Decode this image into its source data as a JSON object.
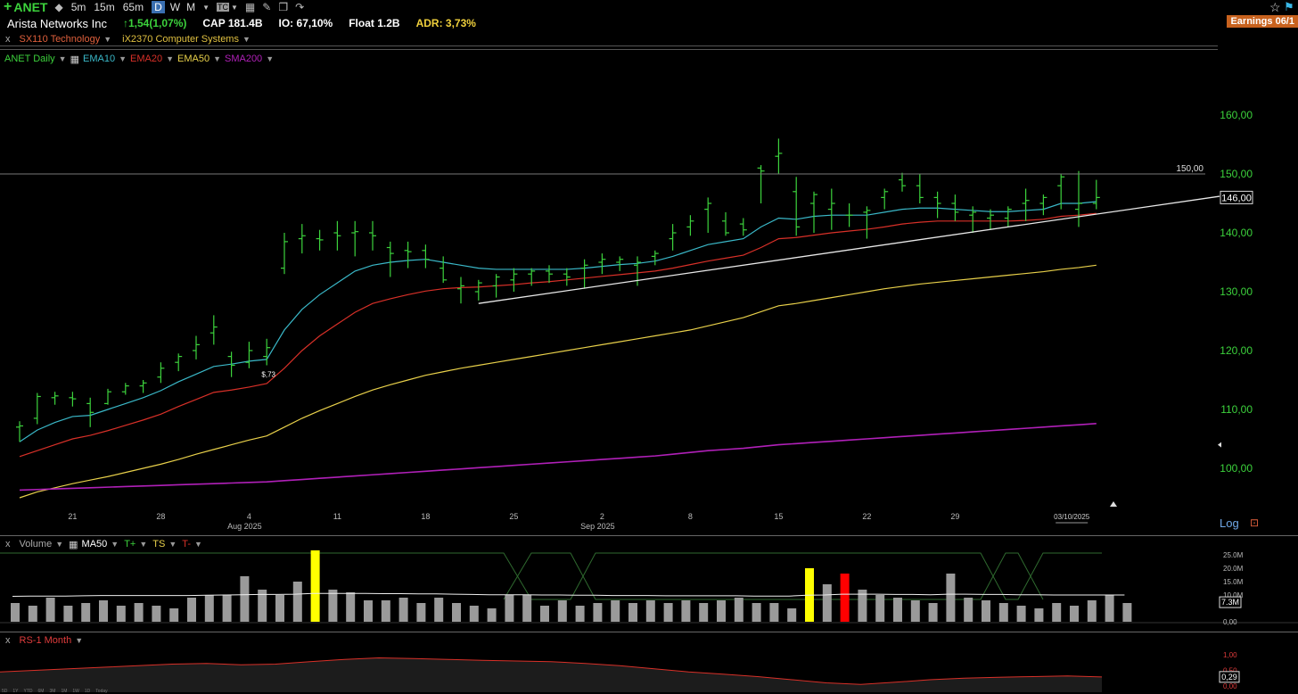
{
  "toolbar": {
    "ticker": "ANET",
    "timeframes": [
      "5m",
      "15m",
      "65m",
      "D",
      "W",
      "M"
    ],
    "active_timeframe": "D",
    "icons": [
      "plus-icon",
      "chart-type-icon",
      "tc-icon",
      "grid-icon",
      "pencil-icon",
      "copy-icon",
      "redo-icon",
      "star-icon",
      "flag-icon"
    ]
  },
  "info": {
    "company": "Arista Networks Inc",
    "change": "↑1,54(1,07%)",
    "cap": "CAP 181.4B",
    "io": "IO: 67,10%",
    "float": "Float 1.2B",
    "adr": "ADR: 3,73%",
    "earnings": "Earnings 06/1"
  },
  "sector": {
    "close": "x",
    "sector": "SX110 Technology",
    "industry": "iX2370 Computer Systems"
  },
  "legend": {
    "symbol": "ANET Daily",
    "ema10": "EMA10",
    "ema20": "EMA20",
    "ema50": "EMA50",
    "sma200": "SMA200",
    "colors": {
      "symbol": "#3cd23c",
      "ema10": "#3ab8c8",
      "ema20": "#d83028",
      "ema50": "#e8d04a",
      "sma200": "#b020b8"
    }
  },
  "chart_data": {
    "type": "ohlc",
    "title": "ANET Daily",
    "ylim": [
      95,
      165
    ],
    "y_ticks": [
      "160,00",
      "150,00",
      "140,00",
      "130,00",
      "120,00",
      "110,00",
      "100,00"
    ],
    "x_ticks": [
      "21",
      "28",
      "4",
      "11",
      "18",
      "25",
      "2",
      "8",
      "15",
      "22",
      "29",
      "03/10/2025"
    ],
    "x_month_labels": [
      "Aug 2025",
      "Sep 2025"
    ],
    "last_price_label": "146,00",
    "level_line_label": "150,00",
    "annotation": "$,73",
    "bars": [
      {
        "o": 107.0,
        "h": 108.0,
        "l": 104.5,
        "c": 107.2
      },
      {
        "o": 108.5,
        "h": 112.8,
        "l": 107.5,
        "c": 112.2
      },
      {
        "o": 112.0,
        "h": 113.0,
        "l": 110.8,
        "c": 112.3
      },
      {
        "o": 112.0,
        "h": 113.0,
        "l": 110.5,
        "c": 111.8
      },
      {
        "o": 111.0,
        "h": 112.0,
        "l": 107.0,
        "c": 109.5
      },
      {
        "o": 111.0,
        "h": 113.5,
        "l": 110.8,
        "c": 113.0
      },
      {
        "o": 113.0,
        "h": 114.5,
        "l": 112.5,
        "c": 114.0
      },
      {
        "o": 114.0,
        "h": 115.0,
        "l": 112.8,
        "c": 114.5
      },
      {
        "o": 115.5,
        "h": 118.0,
        "l": 114.5,
        "c": 117.0
      },
      {
        "o": 118.0,
        "h": 119.5,
        "l": 116.5,
        "c": 119.0
      },
      {
        "o": 120.0,
        "h": 122.5,
        "l": 118.5,
        "c": 121.0
      },
      {
        "o": 123.0,
        "h": 126.0,
        "l": 121.0,
        "c": 124.0
      },
      {
        "o": 119.0,
        "h": 119.8,
        "l": 115.5,
        "c": 117.5
      },
      {
        "o": 118.0,
        "h": 121.5,
        "l": 117.0,
        "c": 120.0
      },
      {
        "o": 119.0,
        "h": 122.0,
        "l": 117.5,
        "c": 120.5
      },
      {
        "o": 134.0,
        "h": 140.0,
        "l": 133.0,
        "c": 138.5
      },
      {
        "o": 139.0,
        "h": 141.5,
        "l": 136.5,
        "c": 139.5
      },
      {
        "o": 139.0,
        "h": 140.5,
        "l": 137.0,
        "c": 138.8
      },
      {
        "o": 140.0,
        "h": 142.0,
        "l": 137.0,
        "c": 139.5
      },
      {
        "o": 140.0,
        "h": 142.0,
        "l": 136.0,
        "c": 140.2
      },
      {
        "o": 140.0,
        "h": 142.0,
        "l": 137.0,
        "c": 139.5
      },
      {
        "o": 137.5,
        "h": 138.5,
        "l": 132.5,
        "c": 136.5
      },
      {
        "o": 137.0,
        "h": 138.5,
        "l": 134.0,
        "c": 136.8
      },
      {
        "o": 137.0,
        "h": 138.0,
        "l": 134.0,
        "c": 135.5
      },
      {
        "o": 134.0,
        "h": 136.0,
        "l": 131.5,
        "c": 132.0
      },
      {
        "o": 130.5,
        "h": 132.5,
        "l": 128.0,
        "c": 131.0
      },
      {
        "o": 130.0,
        "h": 132.0,
        "l": 128.5,
        "c": 131.5
      },
      {
        "o": 131.0,
        "h": 133.0,
        "l": 129.0,
        "c": 132.5
      },
      {
        "o": 132.0,
        "h": 134.0,
        "l": 130.0,
        "c": 133.0
      },
      {
        "o": 133.0,
        "h": 134.0,
        "l": 131.0,
        "c": 133.5
      },
      {
        "o": 133.5,
        "h": 134.5,
        "l": 131.5,
        "c": 133.0
      },
      {
        "o": 133.0,
        "h": 134.0,
        "l": 131.0,
        "c": 132.5
      },
      {
        "o": 134.0,
        "h": 135.5,
        "l": 130.5,
        "c": 134.5
      },
      {
        "o": 135.0,
        "h": 136.5,
        "l": 133.0,
        "c": 135.5
      },
      {
        "o": 135.0,
        "h": 136.0,
        "l": 133.5,
        "c": 135.5
      },
      {
        "o": 134.5,
        "h": 136.0,
        "l": 131.0,
        "c": 135.0
      },
      {
        "o": 136.0,
        "h": 137.0,
        "l": 134.5,
        "c": 136.5
      },
      {
        "o": 139.0,
        "h": 141.5,
        "l": 137.0,
        "c": 140.0
      },
      {
        "o": 141.0,
        "h": 143.0,
        "l": 139.5,
        "c": 142.0
      },
      {
        "o": 144.0,
        "h": 146.0,
        "l": 140.0,
        "c": 145.0
      },
      {
        "o": 142.0,
        "h": 143.5,
        "l": 139.5,
        "c": 140.0
      },
      {
        "o": 141.5,
        "h": 142.5,
        "l": 139.5,
        "c": 140.5
      },
      {
        "o": 151.0,
        "h": 151.5,
        "l": 145.0,
        "c": 150.5
      },
      {
        "o": 153.0,
        "h": 156.0,
        "l": 150.0,
        "c": 153.5
      },
      {
        "o": 147.0,
        "h": 149.5,
        "l": 139.5,
        "c": 141.0
      },
      {
        "o": 145.0,
        "h": 147.0,
        "l": 140.0,
        "c": 146.5
      },
      {
        "o": 144.0,
        "h": 147.5,
        "l": 140.5,
        "c": 145.0
      },
      {
        "o": 143.0,
        "h": 145.0,
        "l": 141.0,
        "c": 143.0
      },
      {
        "o": 143.5,
        "h": 144.5,
        "l": 139.0,
        "c": 143.8
      },
      {
        "o": 146.0,
        "h": 147.5,
        "l": 144.0,
        "c": 147.0
      },
      {
        "o": 149.0,
        "h": 150.2,
        "l": 147.0,
        "c": 148.0
      },
      {
        "o": 148.0,
        "h": 150.0,
        "l": 145.0,
        "c": 146.0
      },
      {
        "o": 146.0,
        "h": 147.0,
        "l": 142.5,
        "c": 145.0
      },
      {
        "o": 145.0,
        "h": 146.5,
        "l": 142.0,
        "c": 143.5
      },
      {
        "o": 143.0,
        "h": 144.5,
        "l": 140.0,
        "c": 143.5
      },
      {
        "o": 142.5,
        "h": 144.0,
        "l": 140.5,
        "c": 143.0
      },
      {
        "o": 142.5,
        "h": 144.5,
        "l": 141.0,
        "c": 144.0
      },
      {
        "o": 145.0,
        "h": 147.5,
        "l": 142.0,
        "c": 145.5
      },
      {
        "o": 145.0,
        "h": 146.5,
        "l": 143.0,
        "c": 146.0
      },
      {
        "o": 148.0,
        "h": 150.0,
        "l": 144.0,
        "c": 149.5
      },
      {
        "o": 144.0,
        "h": 150.5,
        "l": 141.0,
        "c": 145.0
      },
      {
        "o": 145.0,
        "h": 149.0,
        "l": 144.0,
        "c": 146.0
      }
    ],
    "series": [
      {
        "name": "EMA10",
        "color": "#3ab8c8",
        "values": [
          104.5,
          106.5,
          107.8,
          108.8,
          109.0,
          110.0,
          111.0,
          112.0,
          113.2,
          114.7,
          116.0,
          117.3,
          117.7,
          118.2,
          118.5,
          123.5,
          127.0,
          129.5,
          131.5,
          133.5,
          134.5,
          135.0,
          135.3,
          135.5,
          135.0,
          134.5,
          134.0,
          133.8,
          133.8,
          133.8,
          133.8,
          133.8,
          134.0,
          134.3,
          134.6,
          134.8,
          135.2,
          136.0,
          137.0,
          138.0,
          138.5,
          139.0,
          141.0,
          142.5,
          142.3,
          142.8,
          143.0,
          143.0,
          143.0,
          143.5,
          144.0,
          144.2,
          144.2,
          144.0,
          143.8,
          143.6,
          143.6,
          143.8,
          144.0,
          145.0,
          145.0,
          145.3
        ]
      },
      {
        "name": "EMA20",
        "color": "#d83028",
        "values": [
          102.0,
          103.0,
          104.0,
          105.0,
          105.6,
          106.4,
          107.3,
          108.2,
          109.2,
          110.5,
          111.7,
          112.9,
          113.3,
          113.8,
          114.4,
          117.0,
          120.0,
          122.5,
          124.5,
          126.5,
          128.0,
          128.8,
          129.5,
          130.1,
          130.5,
          130.7,
          130.8,
          131.0,
          131.2,
          131.5,
          131.7,
          132.0,
          132.3,
          132.6,
          132.9,
          133.2,
          133.5,
          134.0,
          134.6,
          135.2,
          135.7,
          136.2,
          137.5,
          139.0,
          139.2,
          139.6,
          140.0,
          140.3,
          140.6,
          141.0,
          141.5,
          141.8,
          142.0,
          142.0,
          142.0,
          142.0,
          142.0,
          142.1,
          142.3,
          142.8,
          143.0,
          143.3
        ]
      },
      {
        "name": "EMA50",
        "color": "#e8d04a",
        "values": [
          95.0,
          96.0,
          96.7,
          97.4,
          98.0,
          98.6,
          99.3,
          100.0,
          100.7,
          101.5,
          102.4,
          103.2,
          104.0,
          104.8,
          105.5,
          107.0,
          108.5,
          109.8,
          111.0,
          112.2,
          113.3,
          114.2,
          115.0,
          115.8,
          116.4,
          117.0,
          117.5,
          118.0,
          118.5,
          119.0,
          119.5,
          120.0,
          120.5,
          121.0,
          121.5,
          122.0,
          122.5,
          123.0,
          123.5,
          124.2,
          124.9,
          125.6,
          126.6,
          127.6,
          128.0,
          128.5,
          129.0,
          129.5,
          130.0,
          130.5,
          130.9,
          131.3,
          131.6,
          131.9,
          132.2,
          132.5,
          132.8,
          133.1,
          133.4,
          133.8,
          134.1,
          134.5
        ]
      },
      {
        "name": "SMA200",
        "color": "#b020b8",
        "values": [
          96.3,
          96.4,
          96.5,
          96.6,
          96.7,
          96.8,
          96.9,
          97.0,
          97.1,
          97.2,
          97.3,
          97.4,
          97.5,
          97.6,
          97.7,
          97.9,
          98.1,
          98.3,
          98.5,
          98.7,
          98.9,
          99.1,
          99.3,
          99.5,
          99.7,
          99.9,
          100.1,
          100.3,
          100.5,
          100.7,
          100.9,
          101.1,
          101.3,
          101.5,
          101.7,
          101.9,
          102.1,
          102.4,
          102.7,
          103.0,
          103.2,
          103.4,
          103.7,
          104.0,
          104.2,
          104.4,
          104.6,
          104.8,
          105.0,
          105.2,
          105.4,
          105.6,
          105.8,
          106.0,
          106.2,
          106.4,
          106.6,
          106.8,
          107.0,
          107.2,
          107.4,
          107.6
        ]
      }
    ],
    "trendline": {
      "from": {
        "bar": 26,
        "price": 128.0
      },
      "to": {
        "bar": 62,
        "price": 145.8
      }
    },
    "level": 150,
    "volume": {
      "label": "Volume",
      "ma_label": "MA50",
      "extra_labels": [
        "T+",
        "TS",
        "T-"
      ],
      "y_ticks": [
        "25.0M",
        "20.0M",
        "15.0M",
        "10.0M",
        "0,00"
      ],
      "last_label": "7.3M",
      "ylim": [
        0,
        27
      ],
      "values": [
        7,
        6,
        9,
        6,
        7,
        8,
        6,
        7,
        6,
        5,
        9,
        10,
        10,
        17,
        12,
        10,
        15,
        27,
        12,
        11,
        8,
        8,
        9,
        7,
        9,
        7,
        6,
        5,
        10,
        10,
        6,
        8,
        6,
        7,
        8,
        7,
        8,
        7,
        8,
        7,
        8,
        9,
        7,
        7,
        5,
        20,
        14,
        18,
        12,
        10,
        9,
        8,
        7,
        18,
        9,
        8,
        7,
        6,
        5,
        7,
        6,
        8,
        10,
        7
      ],
      "colors": {
        "normal": "#9a9a9a",
        "high": "#ffff00",
        "low": "#ff0000"
      },
      "special": {
        "17": "high",
        "45": "high",
        "47": "low"
      },
      "ma": [
        9.5,
        9.6,
        9.6,
        9.6,
        9.7,
        9.8,
        9.8,
        9.8,
        9.8,
        9.8,
        9.8,
        9.9,
        10,
        10.1,
        10.2,
        10.2,
        10.3,
        10.6,
        10.6,
        10.6,
        10.6,
        10.5,
        10.5,
        10.4,
        10.4,
        10.3,
        10.2,
        10.1,
        10.1,
        10.1,
        10,
        10,
        9.9,
        9.9,
        9.8,
        9.8,
        9.8,
        9.7,
        9.7,
        9.7,
        9.7,
        9.7,
        9.6,
        9.6,
        9.6,
        9.9,
        10,
        10.3,
        10.3,
        10.3,
        10.2,
        10.2,
        10.1,
        10.3,
        10.3,
        10.2,
        10.2,
        10.1,
        10.1,
        10,
        10,
        10,
        10,
        10
      ]
    },
    "rs": {
      "label": "RS-1 Month",
      "y_ticks": [
        "1,00",
        "0,50",
        "0,00"
      ],
      "last_label": "0,29",
      "ylim": [
        0,
        1
      ],
      "values": [
        0.45,
        0.5,
        0.55,
        0.6,
        0.65,
        0.7,
        0.72,
        0.68,
        0.7,
        0.78,
        0.85,
        0.9,
        0.88,
        0.85,
        0.82,
        0.8,
        0.78,
        0.72,
        0.65,
        0.55,
        0.45,
        0.38,
        0.3,
        0.2,
        0.1,
        0.05,
        0.12,
        0.2,
        0.25,
        0.28,
        0.3,
        0.32,
        0.29
      ]
    }
  },
  "log_label": "Log",
  "timeframe_strip": [
    "5D",
    "1Y",
    "YTD",
    "6M",
    "3M",
    "1M",
    "1W",
    "1D",
    "Today"
  ]
}
